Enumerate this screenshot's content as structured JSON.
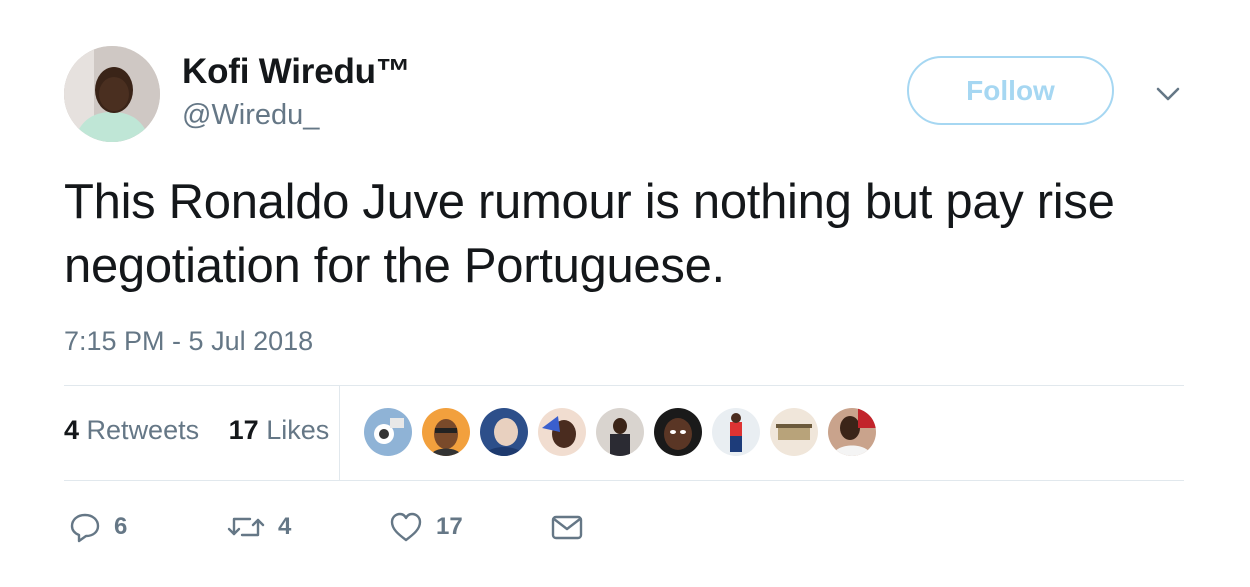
{
  "user": {
    "name": "Kofi Wiredu™",
    "handle": "@Wiredu_"
  },
  "follow_button": {
    "label": "Follow"
  },
  "tweet": {
    "text": "This Ronaldo Juve rumour is nothing but pay rise negotiation for the Portuguese.",
    "timestamp": "7:15 PM - 5 Jul 2018"
  },
  "stats": {
    "retweets_count": "4",
    "retweets_label": "Retweets",
    "likes_count": "17",
    "likes_label": "Likes"
  },
  "actions": {
    "replies": "6",
    "retweets": "4",
    "likes": "17"
  },
  "icons": {
    "reply": "reply-icon",
    "retweet": "retweet-icon",
    "like": "heart-icon",
    "message": "envelope-icon",
    "more": "chevron-down-icon"
  },
  "colors": {
    "follow_accent": "#a6d7f2",
    "secondary_text": "#657786",
    "primary_text": "#14171a",
    "divider": "#e1e8ed"
  }
}
